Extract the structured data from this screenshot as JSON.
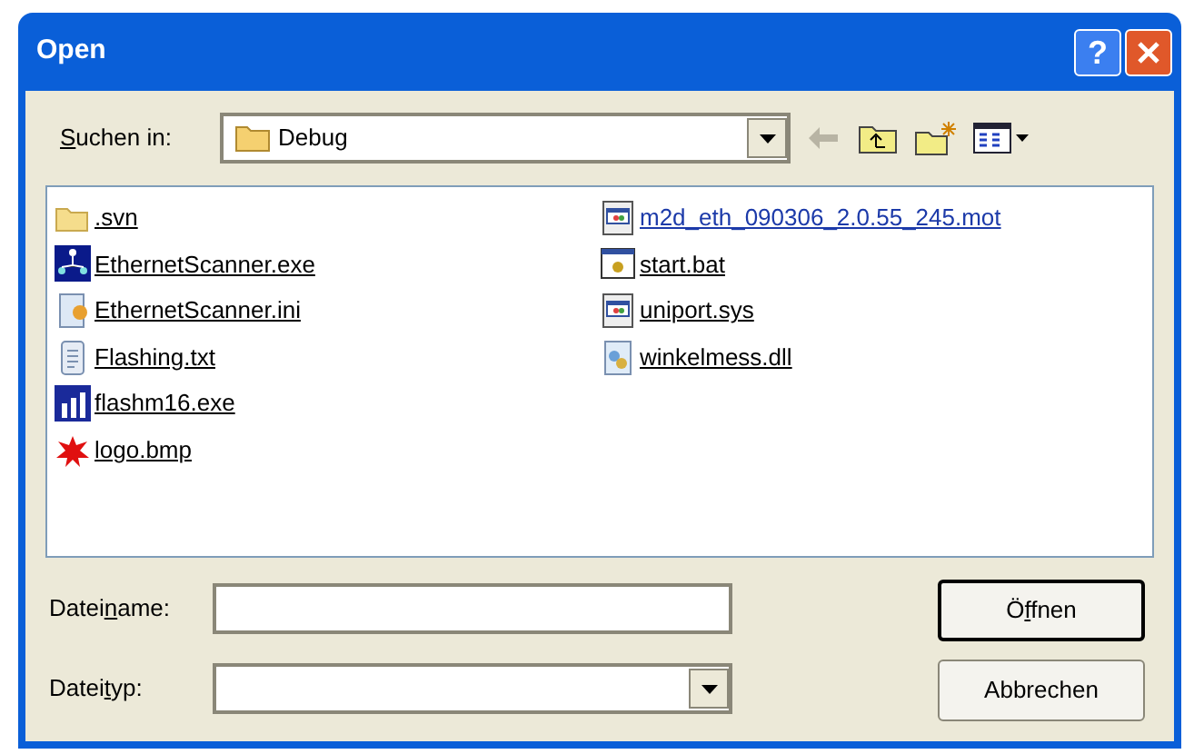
{
  "window": {
    "title": "Open"
  },
  "title_buttons": [
    {
      "kind": "help",
      "label": "?"
    },
    {
      "kind": "close"
    }
  ],
  "look_in": {
    "label": {
      "key": "S",
      "post": "uchen in:"
    },
    "value": "Debug"
  },
  "toolbar": [
    {
      "kind": "back",
      "disabled": true
    },
    {
      "kind": "up"
    },
    {
      "kind": "new-folder"
    },
    {
      "kind": "view"
    }
  ],
  "files": [
    {
      "name": ".svn",
      "kind": "folder",
      "hovered": false
    },
    {
      "name": "EthernetScanner.exe",
      "kind": "network-app",
      "hovered": false
    },
    {
      "name": "EthernetScanner.ini",
      "kind": "settings",
      "hovered": false
    },
    {
      "name": "Flashing.txt",
      "kind": "text",
      "hovered": false
    },
    {
      "name": "flashm16.exe",
      "kind": "bars-app",
      "hovered": false
    },
    {
      "name": "logo.bmp",
      "kind": "paint",
      "hovered": false
    },
    {
      "name": "m2d_eth_090306_2.0.55_245.mot",
      "kind": "window-file",
      "hovered": true
    },
    {
      "name": "start.bat",
      "kind": "batch",
      "hovered": false
    },
    {
      "name": "uniport.sys",
      "kind": "window-file",
      "hovered": false
    },
    {
      "name": "winkelmess.dll",
      "kind": "library",
      "hovered": false
    }
  ],
  "file_name": {
    "label": {
      "pre": "Datei",
      "key": "n",
      "post": "ame:"
    }
  },
  "file_type": {
    "label": {
      "pre": "Datei",
      "key": "t",
      "post": "yp:"
    }
  },
  "buttons": [
    {
      "label": {
        "pre": "Ö",
        "key": "f",
        "post": "fnen"
      },
      "default": true
    },
    {
      "label": {
        "pre": "Abbrechen"
      },
      "default": false
    }
  ]
}
